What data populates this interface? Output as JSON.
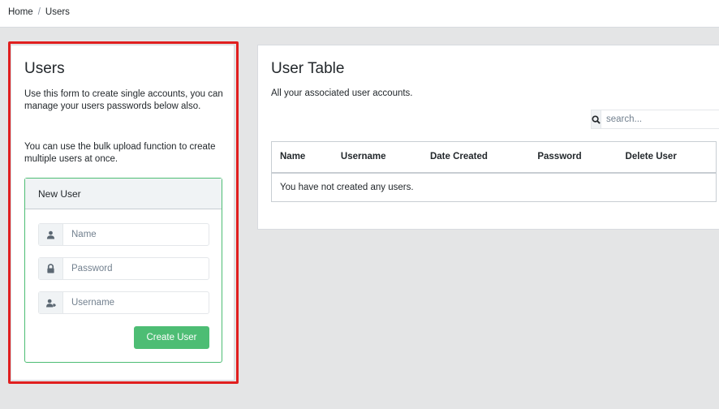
{
  "breadcrumb": {
    "home": "Home",
    "separator": "/",
    "current": "Users"
  },
  "users_panel": {
    "title": "Users",
    "paragraph1": "Use this form to create single accounts, you can manage your users passwords below also.",
    "paragraph2": "You can use the bulk upload function to create multiple users at once.",
    "highlight_color": "#e01f1f"
  },
  "new_user": {
    "header": "New User",
    "name_placeholder": "Name",
    "password_placeholder": "Password",
    "username_placeholder": "Username",
    "name_icon": "user-icon",
    "password_icon": "lock-icon",
    "username_icon": "user-tag-icon",
    "submit_label": "Create User",
    "accent_color": "#4dbd74"
  },
  "user_table": {
    "title": "User Table",
    "subtitle": "All your associated user accounts.",
    "search_placeholder": "search...",
    "search_icon": "search-icon",
    "columns": [
      "Name",
      "Username",
      "Date Created",
      "Password",
      "Delete User"
    ],
    "empty_message": "You have not created any users."
  }
}
